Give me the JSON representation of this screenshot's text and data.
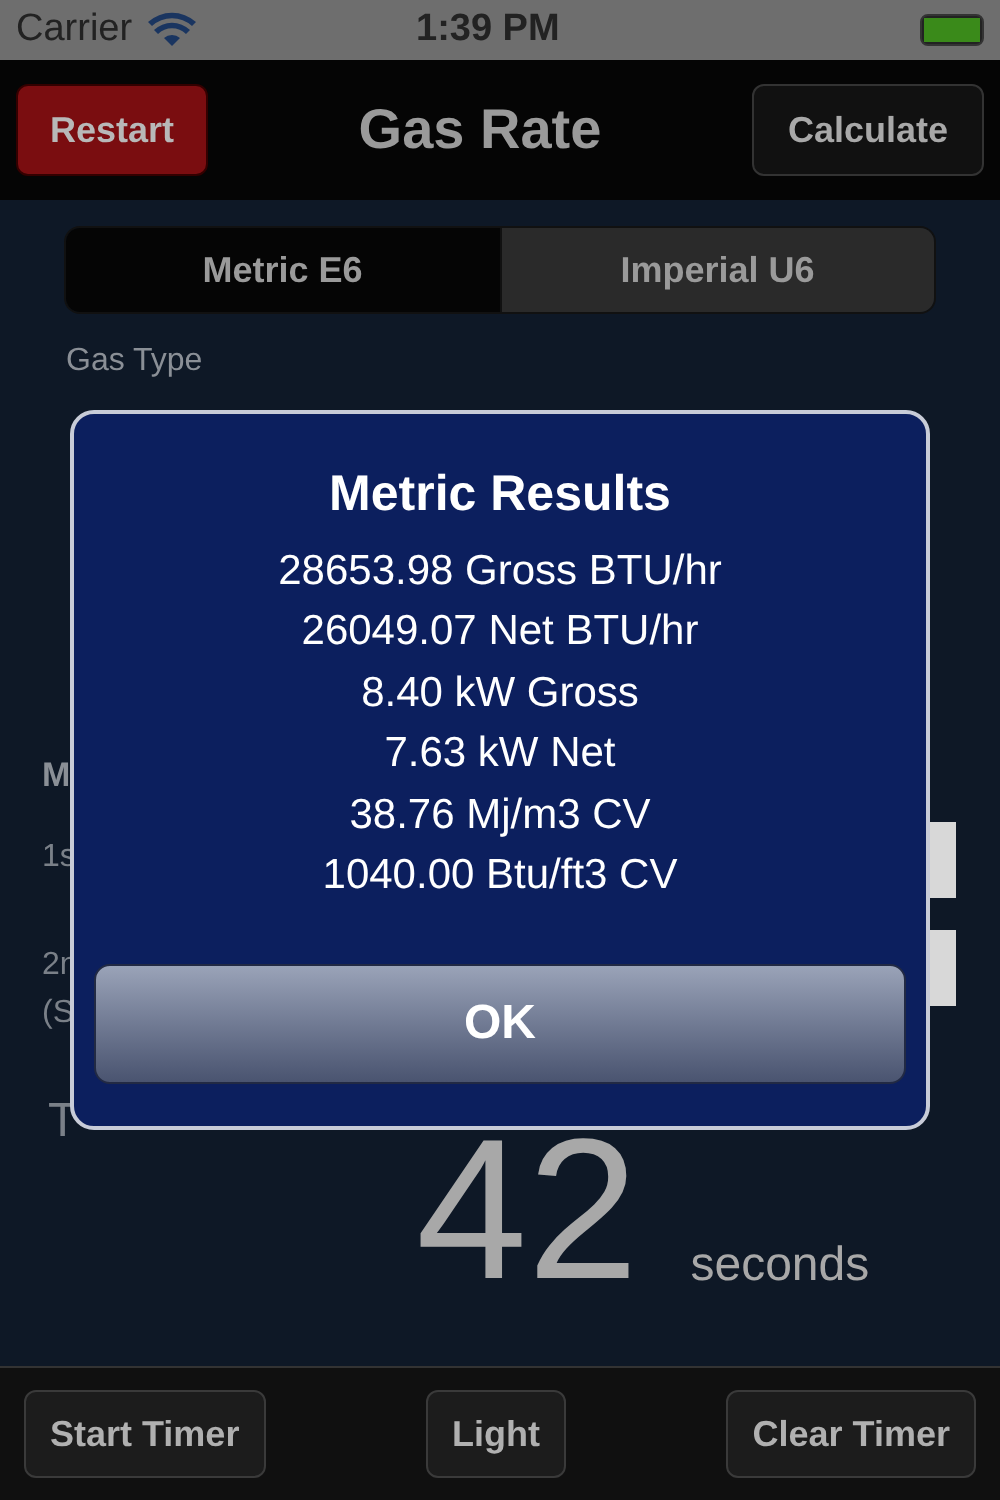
{
  "status_bar": {
    "carrier": "Carrier",
    "time": "1:39 PM"
  },
  "nav_bar": {
    "left_button": "Restart",
    "title": "Gas Rate",
    "right_button": "Calculate"
  },
  "unit_tabs": [
    {
      "label": "Metric E6",
      "selected": true
    },
    {
      "label": "Imperial U6",
      "selected": false
    }
  ],
  "gas_type": {
    "label": "Gas Type"
  },
  "inputs": {
    "heading": "M",
    "readings": [
      {
        "label": "1s"
      },
      {
        "label": "2n",
        "note": "(S"
      }
    ]
  },
  "timer": {
    "label": "T",
    "value": "42",
    "unit": "seconds"
  },
  "toolbar": [
    "Start Timer",
    "Light",
    "Clear Timer"
  ],
  "alert": {
    "title": "Metric Results",
    "lines": [
      "28653.98 Gross BTU/hr",
      "26049.07 Net BTU/hr",
      "8.40 kW Gross",
      "7.63 kW Net",
      "38.76 Mj/m3 CV",
      "1040.00 Btu/ft3 CV"
    ],
    "button": "OK"
  }
}
